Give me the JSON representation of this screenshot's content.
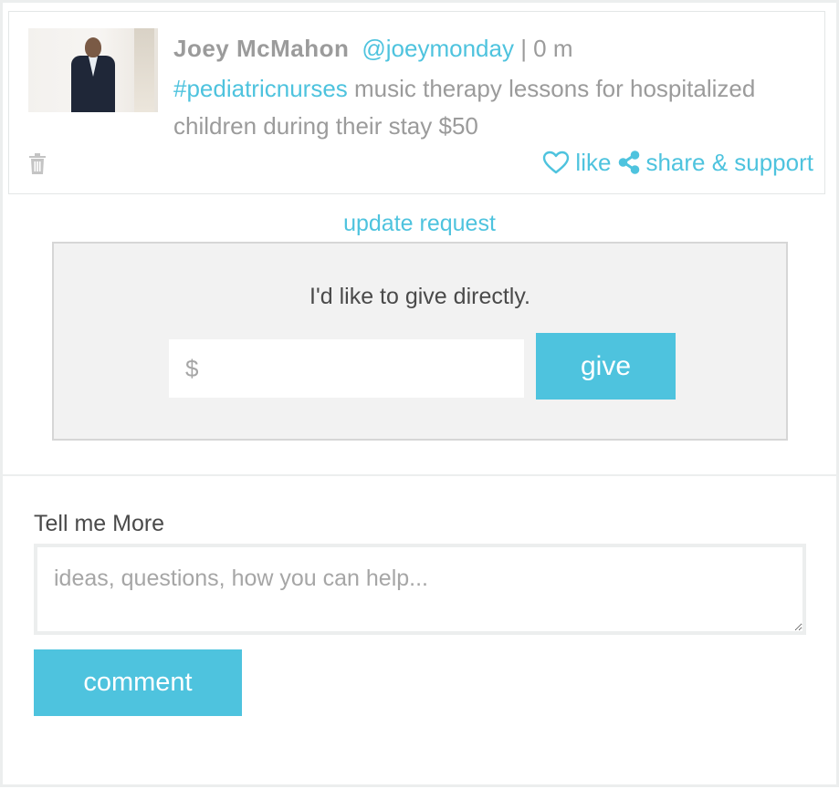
{
  "post": {
    "author": "Joey McMahon",
    "handle": "@joeymonday",
    "meta": " | 0 m",
    "hashtag": "#pediatricnurses",
    "text": " music therapy lessons for hospitalized children during their stay $50",
    "like_label": "like",
    "share_label": "share & support",
    "icons": {
      "delete": "trash-icon",
      "like": "heart-icon",
      "share": "share-icon"
    }
  },
  "update_request": "update request",
  "give": {
    "title": "I'd like to give directly.",
    "placeholder": "$",
    "button_label": "give"
  },
  "comment": {
    "label": "Tell me More",
    "placeholder": "ideas, questions, how you can help...",
    "button_label": "comment"
  },
  "colors": {
    "accent": "#4ec3de",
    "muted_text": "#9b9b9b",
    "panel_bg": "#f2f2f2"
  }
}
